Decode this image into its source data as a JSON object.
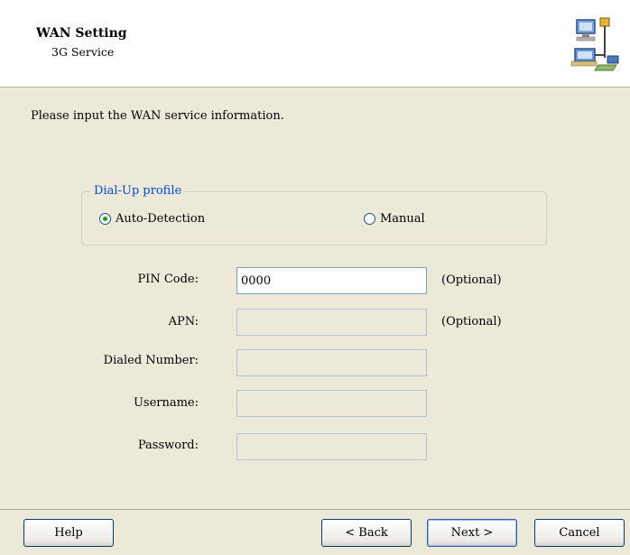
{
  "header": {
    "title": "WAN Setting",
    "subtitle": "3G Service",
    "icon": "network-computers-icon"
  },
  "intro_text": "Please input the WAN service information.",
  "dialup_profile": {
    "legend": "Dial-Up profile",
    "options": [
      {
        "label": "Auto-Detection",
        "selected": true
      },
      {
        "label": "Manual",
        "selected": false
      }
    ]
  },
  "fields": {
    "pin_code": {
      "label": "PIN Code:",
      "value": "0000",
      "note": "(Optional)",
      "enabled": true
    },
    "apn": {
      "label": "APN:",
      "value": "",
      "note": "(Optional)",
      "enabled": false
    },
    "dialed_number": {
      "label": "Dialed Number:",
      "value": "",
      "enabled": false
    },
    "username": {
      "label": "Username:",
      "value": "",
      "enabled": false
    },
    "password": {
      "label": "Password:",
      "value": "",
      "enabled": false
    }
  },
  "buttons": {
    "help": "Help",
    "back": "< Back",
    "next": "Next >",
    "cancel": "Cancel"
  },
  "colors": {
    "dialog_background": "#ECE9D8",
    "header_background": "#FFFFFF",
    "legend_text": "#0046D5",
    "radio_dot": "#21A121"
  }
}
